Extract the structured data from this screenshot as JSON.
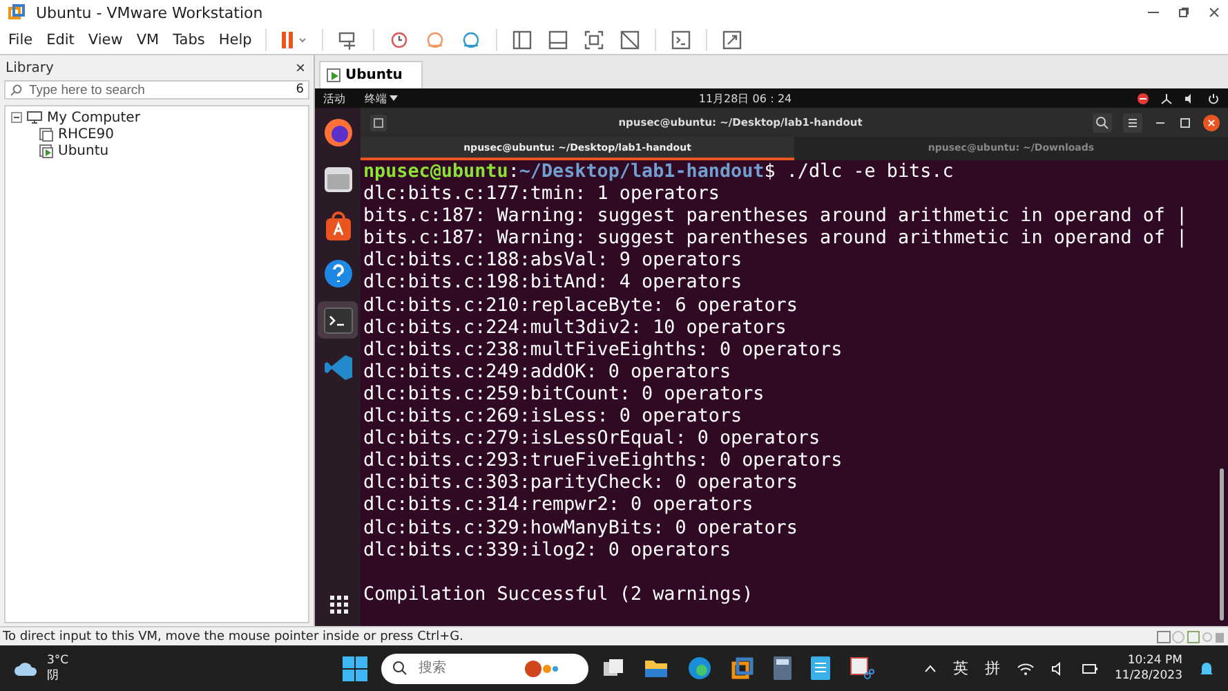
{
  "window": {
    "title": "Ubuntu - VMware Workstation"
  },
  "menu": [
    "File",
    "Edit",
    "View",
    "VM",
    "Tabs",
    "Help"
  ],
  "library": {
    "title": "Library",
    "close": "×",
    "search": {
      "placeholder": "Type here to search",
      "count": "6"
    },
    "tree": [
      {
        "label": "My Computer",
        "expanded": true,
        "children": [
          {
            "label": "RHCE90",
            "running": false,
            "selected": false
          },
          {
            "label": "Ubuntu",
            "running": true,
            "selected": false
          }
        ]
      }
    ]
  },
  "vm_tabs": [
    {
      "label": "Ubuntu",
      "selected": true
    }
  ],
  "ubuntu": {
    "activities": "活动",
    "app": "终端",
    "clock": "11月28日 06：24",
    "dock": [
      {
        "kind": "firefox",
        "selected": false
      },
      {
        "kind": "files",
        "selected": false
      },
      {
        "kind": "store",
        "selected": false
      },
      {
        "kind": "help",
        "selected": false
      },
      {
        "kind": "terminal",
        "selected": true
      },
      {
        "kind": "vscode",
        "selected": false
      }
    ]
  },
  "terminal": {
    "title": "npusec@ubuntu: ~/Desktop/lab1-handout",
    "tabs": [
      {
        "label": "npusec@ubuntu: ~/Desktop/lab1-handout",
        "selected": true
      },
      {
        "label": "npusec@ubuntu: ~/Downloads",
        "selected": false
      }
    ],
    "lines": [
      {
        "kind": "prompt",
        "user": "npusec@ubuntu",
        "separator": ":",
        "path": "~/Desktop/lab1-handout",
        "command": "$ ./dlc -e bits.c"
      },
      {
        "kind": "text",
        "text": "dlc:bits.c:177:tmin: 1 operators"
      },
      {
        "kind": "text",
        "text": "bits.c:187: Warning: suggest parentheses around arithmetic in operand of |"
      },
      {
        "kind": "text",
        "text": "bits.c:187: Warning: suggest parentheses around arithmetic in operand of |"
      },
      {
        "kind": "text",
        "text": "dlc:bits.c:188:absVal: 9 operators"
      },
      {
        "kind": "text",
        "text": "dlc:bits.c:198:bitAnd: 4 operators"
      },
      {
        "kind": "text",
        "text": "dlc:bits.c:210:replaceByte: 6 operators"
      },
      {
        "kind": "text",
        "text": "dlc:bits.c:224:mult3div2: 10 operators"
      },
      {
        "kind": "text",
        "text": "dlc:bits.c:238:multFiveEighths: 0 operators"
      },
      {
        "kind": "text",
        "text": "dlc:bits.c:249:addOK: 0 operators"
      },
      {
        "kind": "text",
        "text": "dlc:bits.c:259:bitCount: 0 operators"
      },
      {
        "kind": "text",
        "text": "dlc:bits.c:269:isLess: 0 operators"
      },
      {
        "kind": "text",
        "text": "dlc:bits.c:279:isLessOrEqual: 0 operators"
      },
      {
        "kind": "text",
        "text": "dlc:bits.c:293:trueFiveEighths: 0 operators"
      },
      {
        "kind": "text",
        "text": "dlc:bits.c:303:parityCheck: 0 operators"
      },
      {
        "kind": "text",
        "text": "dlc:bits.c:314:rempwr2: 0 operators"
      },
      {
        "kind": "text",
        "text": "dlc:bits.c:329:howManyBits: 0 operators"
      },
      {
        "kind": "text",
        "text": "dlc:bits.c:339:ilog2: 0 operators"
      },
      {
        "kind": "blank"
      },
      {
        "kind": "text",
        "text": "Compilation Successful (2 warnings)"
      }
    ]
  },
  "status_bar": "To direct input to this VM, move the mouse pointer inside or press Ctrl+G.",
  "taskbar": {
    "temperature": "3°C",
    "condition": "阴",
    "search": {
      "placeholder": "搜索"
    },
    "input_lang": "英",
    "input_mode": "拼",
    "time": "10:24 PM",
    "date": "11/28/2023"
  }
}
